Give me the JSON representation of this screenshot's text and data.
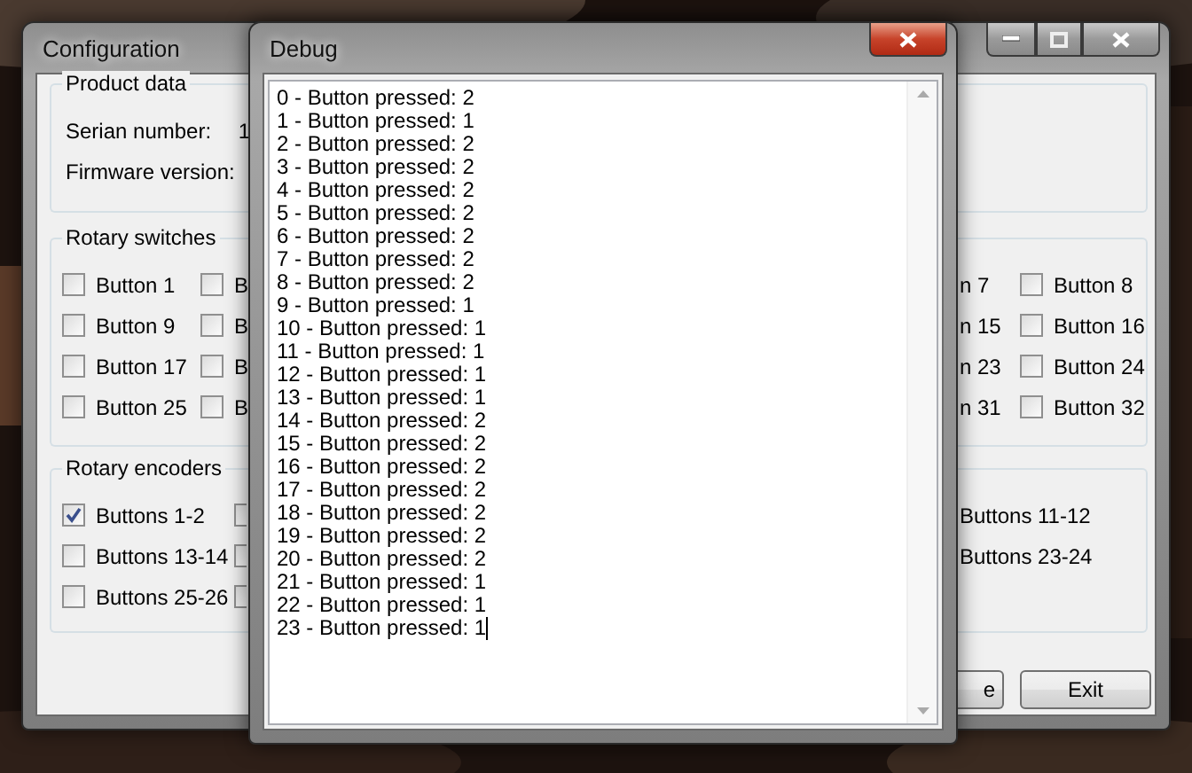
{
  "config_window": {
    "title": "Configuration",
    "product_data": {
      "title": "Product data",
      "fields": [
        {
          "label": "Serian number:",
          "value": "1"
        },
        {
          "label": "Firmware version:"
        }
      ]
    },
    "rotary_switches": {
      "title": "Rotary switches",
      "rows": [
        {
          "left": [
            {
              "label": "Button 1",
              "checked": false
            },
            {
              "label": "B",
              "checked": false
            }
          ],
          "right": [
            {
              "label": "n 7"
            },
            {
              "label": "Button 8",
              "checked": false
            }
          ]
        },
        {
          "left": [
            {
              "label": "Button 9",
              "checked": false
            },
            {
              "label": "B",
              "checked": false
            }
          ],
          "right": [
            {
              "label": "n 15"
            },
            {
              "label": "Button 16",
              "checked": false
            }
          ]
        },
        {
          "left": [
            {
              "label": "Button 17",
              "checked": false
            },
            {
              "label": "B",
              "checked": false
            }
          ],
          "right": [
            {
              "label": "n 23"
            },
            {
              "label": "Button 24",
              "checked": false
            }
          ]
        },
        {
          "left": [
            {
              "label": "Button 25",
              "checked": false
            },
            {
              "label": "B",
              "checked": false
            }
          ],
          "right": [
            {
              "label": "n 31"
            },
            {
              "label": "Button 32",
              "checked": false
            }
          ]
        }
      ]
    },
    "rotary_encoders": {
      "title": "Rotary encoders",
      "rows": [
        {
          "left": [
            {
              "label": "Buttons 1-2",
              "checked": true
            },
            {
              "checked": false
            }
          ],
          "right": [
            {
              "label": "Buttons 11-12"
            }
          ]
        },
        {
          "left": [
            {
              "label": "Buttons 13-14",
              "checked": false
            },
            {
              "checked": false
            }
          ],
          "right": [
            {
              "label": "Buttons 23-24"
            }
          ]
        },
        {
          "left": [
            {
              "label": "Buttons 25-26",
              "checked": false
            },
            {
              "checked": false
            }
          ],
          "right": []
        }
      ]
    },
    "buttons": [
      {
        "label": "e"
      },
      {
        "label": "Exit"
      }
    ]
  },
  "debug_window": {
    "title": "Debug",
    "lines": [
      "0 - Button pressed: 2",
      "1 - Button pressed: 1",
      "2 - Button pressed: 2",
      "3 - Button pressed: 2",
      "4 - Button pressed: 2",
      "5 - Button pressed: 2",
      "6 - Button pressed: 2",
      "7 - Button pressed: 2",
      "8 - Button pressed: 2",
      "9 - Button pressed: 1",
      "10 - Button pressed: 1",
      "11 - Button pressed: 1",
      "12 - Button pressed: 1",
      "13 - Button pressed: 1",
      "14 - Button pressed: 2",
      "15 - Button pressed: 2",
      "16 - Button pressed: 2",
      "17 - Button pressed: 2",
      "18 - Button pressed: 2",
      "19 - Button pressed: 2",
      "20 - Button pressed: 2",
      "21 - Button pressed: 1",
      "22 - Button pressed: 1",
      "23 - Button pressed: 1"
    ]
  }
}
